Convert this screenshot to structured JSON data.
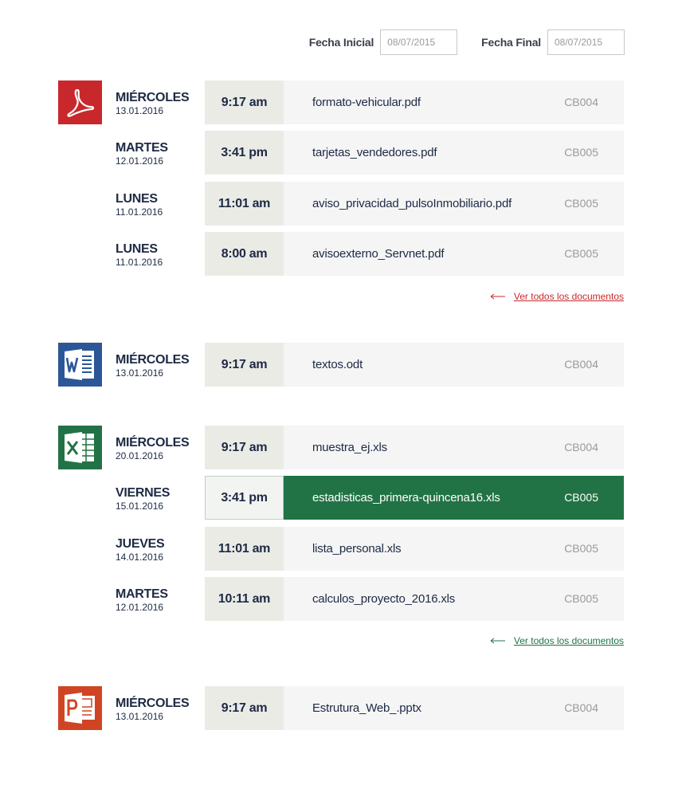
{
  "filters": {
    "start_label": "Fecha Inicial",
    "start_value": "08/07/2015",
    "end_label": "Fecha Final",
    "end_value": "08/07/2015"
  },
  "colors": {
    "pdf": "#c8282c",
    "word": "#2b5797",
    "excel": "#217346",
    "powerpoint": "#d04423"
  },
  "groups": [
    {
      "icon": "pdf-icon",
      "rows": [
        {
          "day": "MIÉRCOLES",
          "date": "13.01.2016",
          "time": "9:17 am",
          "file": "formato-vehicular.pdf",
          "code": "CB004"
        },
        {
          "day": "MARTES",
          "date": "12.01.2016",
          "time": "3:41 pm",
          "file": "tarjetas_vendedores.pdf",
          "code": "CB005"
        },
        {
          "day": "LUNES",
          "date": "11.01.2016",
          "time": "11:01 am",
          "file": "aviso_privacidad_pulsoInmobiliario.pdf",
          "code": "CB005"
        },
        {
          "day": "LUNES",
          "date": "11.01.2016",
          "time": "8:00 am",
          "file": "avisoexterno_Servnet.pdf",
          "code": "CB005"
        }
      ],
      "see_all": "Ver todos los documentos"
    },
    {
      "icon": "word-icon",
      "rows": [
        {
          "day": "MIÉRCOLES",
          "date": "13.01.2016",
          "time": "9:17 am",
          "file": "textos.odt",
          "code": "CB004"
        }
      ]
    },
    {
      "icon": "excel-icon",
      "rows": [
        {
          "day": "MIÉRCOLES",
          "date": "20.01.2016",
          "time": "9:17 am",
          "file": "muestra_ej.xls",
          "code": "CB004"
        },
        {
          "day": "VIERNES",
          "date": "15.01.2016",
          "time": "3:41 pm",
          "file": "estadisticas_primera-quincena16.xls",
          "code": "CB005"
        },
        {
          "day": "JUEVES",
          "date": "14.01.2016",
          "time": "11:01 am",
          "file": "lista_personal.xls",
          "code": "CB005"
        },
        {
          "day": "MARTES",
          "date": "12.01.2016",
          "time": "10:11 am",
          "file": "calculos_proyecto_2016.xls",
          "code": "CB005"
        }
      ],
      "see_all": "Ver todos los documentos"
    },
    {
      "icon": "powerpoint-icon",
      "rows": [
        {
          "day": "MIÉRCOLES",
          "date": "13.01.2016",
          "time": "9:17 am",
          "file": "Estrutura_Web_.pptx",
          "code": "CB004"
        }
      ]
    }
  ]
}
